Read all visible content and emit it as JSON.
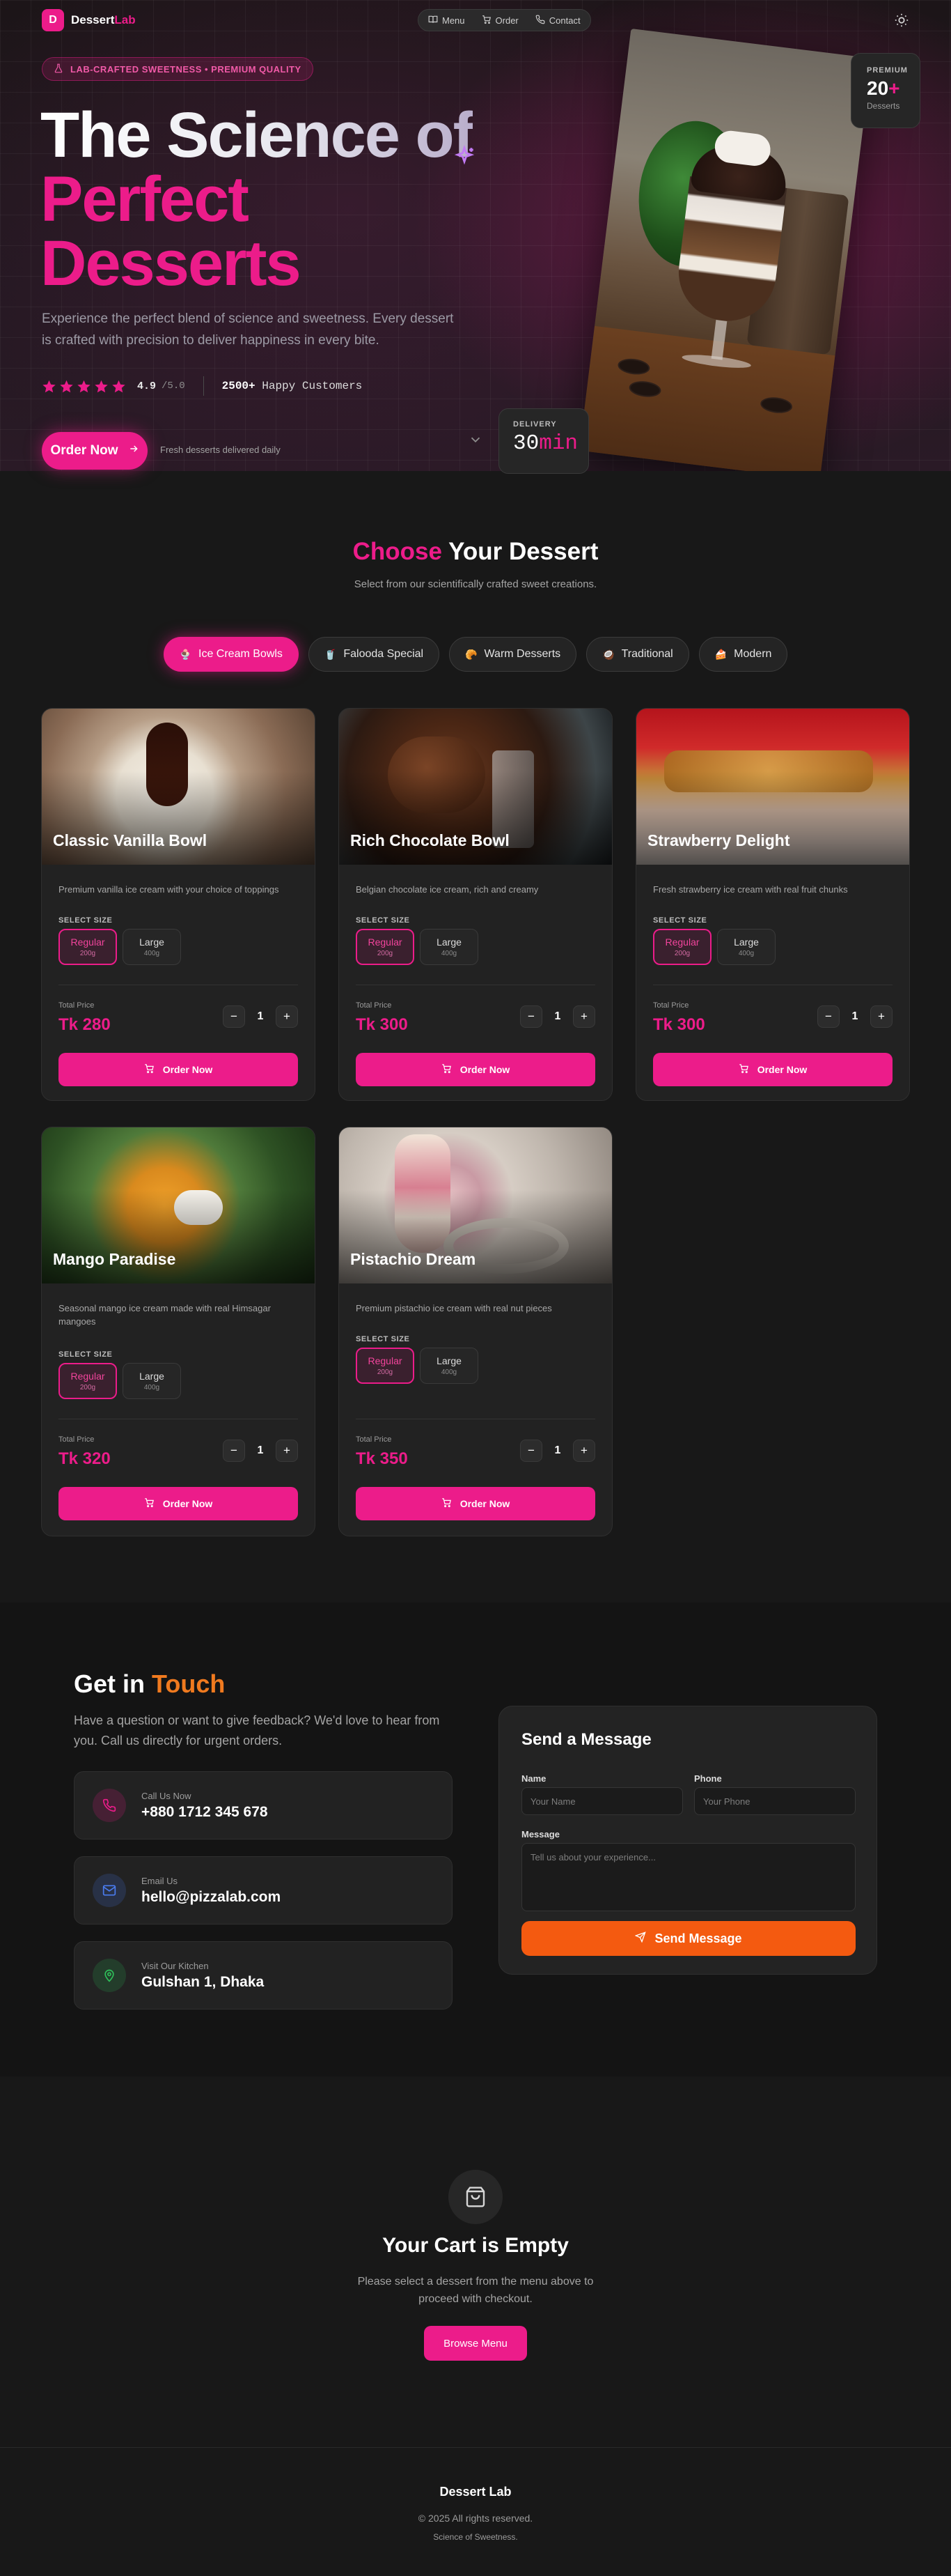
{
  "brand": {
    "initial": "D",
    "name_a": "Dessert",
    "name_b": "Lab",
    "accent": "#ec1c8a"
  },
  "nav": {
    "items": [
      {
        "label": "Menu",
        "icon": "book-icon"
      },
      {
        "label": "Order",
        "icon": "cart-icon"
      },
      {
        "label": "Contact",
        "icon": "phone-icon"
      }
    ],
    "theme_icon": "sun-icon"
  },
  "hero": {
    "badge": "LAB-CRAFTED SWEETNESS • PREMIUM QUALITY",
    "title_line1": "The Science of",
    "title_line2": "Perfect",
    "title_line3": "Desserts",
    "description": "Experience the perfect blend of science and sweetness. Every dessert is crafted with precision to deliver happiness in every bite.",
    "rating_value": "4.9",
    "rating_max": "/5.0",
    "rating_stars": 5,
    "happy_count": "2500+",
    "happy_label": "Happy Customers",
    "order_button": "Order Now",
    "fresh_note": "Fresh desserts delivered daily",
    "premium_label": "PREMIUM",
    "premium_value": "20",
    "premium_plus": "+",
    "premium_sub": "Desserts",
    "delivery_label": "DELIVERY",
    "delivery_value": "30",
    "delivery_unit": "min"
  },
  "menu": {
    "title_a": "Choose",
    "title_b": "Your Dessert",
    "subtitle": "Select from our scientifically crafted sweet creations.",
    "tabs": [
      {
        "label": "Ice Cream Bowls",
        "emoji": "🍨",
        "active": true
      },
      {
        "label": "Falooda Special",
        "emoji": "🥤",
        "active": false
      },
      {
        "label": "Warm Desserts",
        "emoji": "🥐",
        "active": false
      },
      {
        "label": "Traditional",
        "emoji": "🥥",
        "active": false
      },
      {
        "label": "Modern",
        "emoji": "🍰",
        "active": false
      }
    ],
    "labels": {
      "select_size": "SELECT SIZE",
      "total_price": "Total Price",
      "order_now": "Order Now"
    },
    "items": [
      {
        "name": "Classic Vanilla Bowl",
        "description": "Premium vanilla ice cream with your choice of toppings",
        "sizes": [
          {
            "label": "Regular",
            "grams": "200g",
            "selected": true
          },
          {
            "label": "Large",
            "grams": "400g",
            "selected": false
          }
        ],
        "price": "Tk 280",
        "qty": "1"
      },
      {
        "name": "Rich Chocolate Bowl",
        "description": "Belgian chocolate ice cream, rich and creamy",
        "sizes": [
          {
            "label": "Regular",
            "grams": "200g",
            "selected": true
          },
          {
            "label": "Large",
            "grams": "400g",
            "selected": false
          }
        ],
        "price": "Tk 300",
        "qty": "1"
      },
      {
        "name": "Strawberry Delight",
        "description": "Fresh strawberry ice cream with real fruit chunks",
        "sizes": [
          {
            "label": "Regular",
            "grams": "200g",
            "selected": true
          },
          {
            "label": "Large",
            "grams": "400g",
            "selected": false
          }
        ],
        "price": "Tk 300",
        "qty": "1"
      },
      {
        "name": "Mango Paradise",
        "description": "Seasonal mango ice cream made with real Himsagar mangoes",
        "sizes": [
          {
            "label": "Regular",
            "grams": "200g",
            "selected": true
          },
          {
            "label": "Large",
            "grams": "400g",
            "selected": false
          }
        ],
        "price": "Tk 320",
        "qty": "1"
      },
      {
        "name": "Pistachio Dream",
        "description": "Premium pistachio ice cream with real nut pieces",
        "sizes": [
          {
            "label": "Regular",
            "grams": "200g",
            "selected": true
          },
          {
            "label": "Large",
            "grams": "400g",
            "selected": false
          }
        ],
        "price": "Tk 350",
        "qty": "1"
      }
    ]
  },
  "contact": {
    "title_a": "Get in",
    "title_b": "Touch",
    "subtitle": "Have a question or want to give feedback? We'd love to hear from you. Call us directly for urgent orders.",
    "info": [
      {
        "label": "Call Us Now",
        "value": "+880 1712 345 678",
        "icon": "phone-icon",
        "color": "#ec1c8a"
      },
      {
        "label": "Email Us",
        "value": "hello@pizzalab.com",
        "icon": "mail-icon",
        "color": "#4a7cf0"
      },
      {
        "label": "Visit Our Kitchen",
        "value": "Gulshan 1, Dhaka",
        "icon": "map-pin-icon",
        "color": "#2fbf5a"
      }
    ],
    "form": {
      "title": "Send a Message",
      "name_label": "Name",
      "name_placeholder": "Your Name",
      "phone_label": "Phone",
      "phone_placeholder": "Your Phone",
      "message_label": "Message",
      "message_placeholder": "Tell us about your experience...",
      "send": "Send Message",
      "send_color": "#f45a10"
    }
  },
  "cart": {
    "title": "Your Cart is Empty",
    "subtitle": "Please select a dessert from the menu above to proceed with checkout.",
    "button": "Browse Menu"
  },
  "footer": {
    "brand": "Dessert Lab",
    "copyright": "© 2025 All rights reserved.",
    "tagline": "Science of Sweetness."
  }
}
